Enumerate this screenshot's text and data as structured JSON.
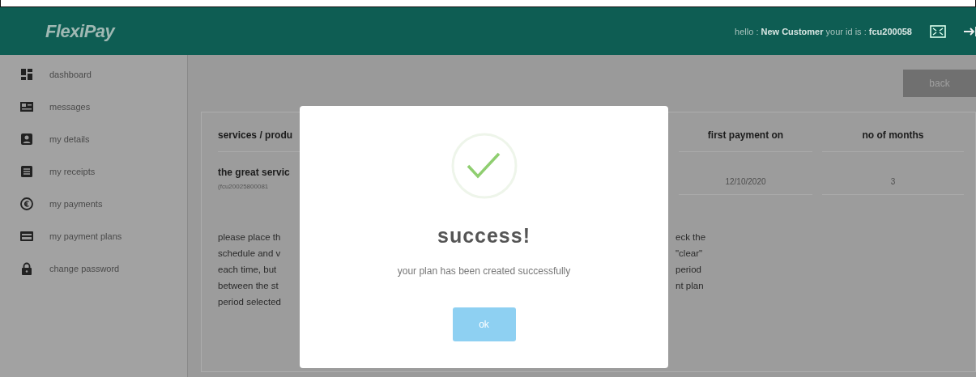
{
  "header": {
    "logo": "FlexiPay",
    "greeting": "hello :",
    "user_name": "New Customer",
    "id_label": "your id is :",
    "user_id": "fcu200058"
  },
  "sidebar": {
    "items": [
      {
        "label": "dashboard"
      },
      {
        "label": "messages"
      },
      {
        "label": "my details"
      },
      {
        "label": "my receipts"
      },
      {
        "label": "my payments"
      },
      {
        "label": "my payment plans"
      },
      {
        "label": "change password"
      }
    ]
  },
  "back_button": "back",
  "table": {
    "columns": [
      "services / produ",
      "first payment on",
      "no of months"
    ],
    "rows": [
      {
        "service": "the great servic",
        "service_id": "(fcu20025800081",
        "first_payment": "12/10/2020",
        "months": "3"
      }
    ]
  },
  "notice": {
    "left_lines": [
      "please place th",
      "schedule and v",
      "each time, but",
      "between the st",
      "period selected"
    ],
    "right_lines": [
      "eck the",
      "\"clear\"",
      "period",
      "nt plan"
    ]
  },
  "dialog": {
    "title": "success!",
    "message": "your plan has been created successfully",
    "ok_button": "ok"
  }
}
